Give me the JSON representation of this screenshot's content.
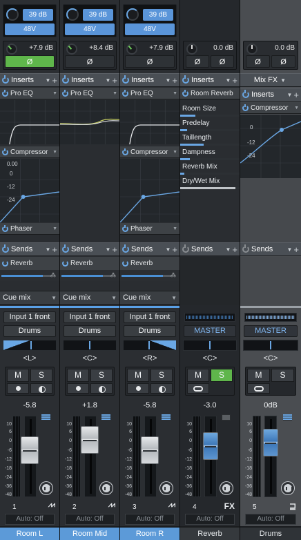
{
  "channels": [
    {
      "gain": "39 dB",
      "phantom": "48V",
      "trim": "+7.9 dB",
      "phase": "Ø",
      "inserts_label": "Inserts",
      "plugins": [
        "Pro EQ",
        "Compressor",
        "Phaser"
      ],
      "comp_scale": [
        "0.00",
        "0",
        "-12",
        "-24"
      ],
      "sends_label": "Sends",
      "send_slot": "Reverb",
      "cue": "Cue mix",
      "input": "Input 1 front",
      "output": "Drums",
      "pan": "<L>",
      "mute": "M",
      "solo": "S",
      "volume": "-5.8",
      "scale": [
        "10",
        "6",
        "0",
        "-6",
        "-12",
        "-18",
        "-24",
        "-36",
        "-48"
      ],
      "number": "1",
      "auto": "Auto: Off",
      "name": "Room L"
    },
    {
      "gain": "39 dB",
      "phantom": "48V",
      "trim": "+8.4 dB",
      "phase": "Ø",
      "inserts_label": "Inserts",
      "plugins": [
        "Pro EQ"
      ],
      "sends_label": "Sends",
      "send_slot": "Reverb",
      "cue": "Cue mix",
      "input": "Input 1 front",
      "output": "Drums",
      "pan": "<C>",
      "mute": "M",
      "solo": "S",
      "volume": "+1.8",
      "scale": [
        "10",
        "6",
        "0",
        "-6",
        "-12",
        "-18",
        "-24",
        "-36",
        "-48"
      ],
      "number": "2",
      "auto": "Auto: Off",
      "name": "Room Mid"
    },
    {
      "gain": "39 dB",
      "phantom": "48V",
      "trim": "+7.9 dB",
      "phase": "Ø",
      "inserts_label": "Inserts",
      "plugins": [
        "Pro EQ",
        "Compressor",
        "Phaser"
      ],
      "sends_label": "Sends",
      "send_slot": "Reverb",
      "cue": "Cue mix",
      "input": "Input 1 front",
      "output": "Drums",
      "pan": "<R>",
      "mute": "M",
      "solo": "S",
      "volume": "-5.8",
      "scale": [
        "10",
        "6",
        "0",
        "-6",
        "-12",
        "-18",
        "-24",
        "-36",
        "-48"
      ],
      "number": "3",
      "auto": "Auto: Off",
      "name": "Room R"
    },
    {
      "trim": "0.0 dB",
      "phase": "Ø",
      "inserts_label": "Inserts",
      "plugins": [
        "Room Reverb"
      ],
      "params": [
        "Room Size",
        "Predelay",
        "Taillength",
        "Dampness",
        "Reverb Mix",
        "Dry/Wet Mix"
      ],
      "sends_label": "Sends",
      "output": "MASTER",
      "pan": "<C>",
      "mute": "M",
      "solo": "S",
      "volume": "-3.0",
      "scale": [
        "10",
        "6",
        "0",
        "-6",
        "-12",
        "-18",
        "-24",
        "-36",
        "-48"
      ],
      "number": "4",
      "type": "FX",
      "auto": "Auto: Off",
      "name": "Reverb"
    },
    {
      "trim": "0.0 dB",
      "phase": "Ø",
      "inserts_label": "Mix FX",
      "plugins": [
        "Inserts",
        "Compressor"
      ],
      "comp_scale": [
        "0",
        "-12",
        "-24"
      ],
      "sends_label": "Sends",
      "output": "MASTER",
      "pan": "<C>",
      "mute": "M",
      "solo": "S",
      "volume": "0dB",
      "scale": [
        "10",
        "6",
        "0",
        "-6",
        "-12",
        "-18",
        "-24",
        "-36",
        "-48"
      ],
      "number": "5",
      "auto": "Auto: Off",
      "name": "Drums"
    }
  ],
  "colors": {
    "accent": "#5a95d9",
    "solo_on": "#5fb64b",
    "phase_on": "#5fb64b"
  }
}
